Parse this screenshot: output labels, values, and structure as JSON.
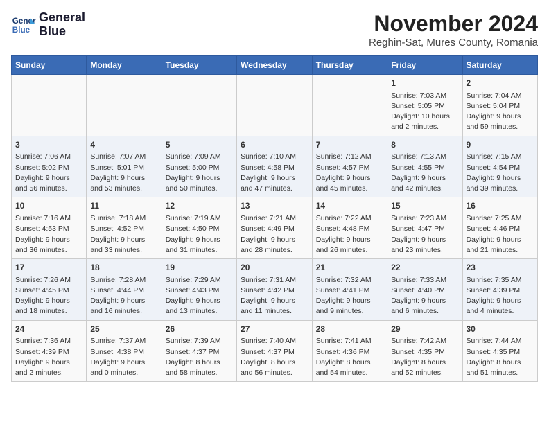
{
  "header": {
    "logo_line1": "General",
    "logo_line2": "Blue",
    "month_title": "November 2024",
    "subtitle": "Reghin-Sat, Mures County, Romania"
  },
  "weekdays": [
    "Sunday",
    "Monday",
    "Tuesday",
    "Wednesday",
    "Thursday",
    "Friday",
    "Saturday"
  ],
  "weeks": [
    [
      {
        "day": "",
        "details": ""
      },
      {
        "day": "",
        "details": ""
      },
      {
        "day": "",
        "details": ""
      },
      {
        "day": "",
        "details": ""
      },
      {
        "day": "",
        "details": ""
      },
      {
        "day": "1",
        "details": "Sunrise: 7:03 AM\nSunset: 5:05 PM\nDaylight: 10 hours\nand 2 minutes."
      },
      {
        "day": "2",
        "details": "Sunrise: 7:04 AM\nSunset: 5:04 PM\nDaylight: 9 hours\nand 59 minutes."
      }
    ],
    [
      {
        "day": "3",
        "details": "Sunrise: 7:06 AM\nSunset: 5:02 PM\nDaylight: 9 hours\nand 56 minutes."
      },
      {
        "day": "4",
        "details": "Sunrise: 7:07 AM\nSunset: 5:01 PM\nDaylight: 9 hours\nand 53 minutes."
      },
      {
        "day": "5",
        "details": "Sunrise: 7:09 AM\nSunset: 5:00 PM\nDaylight: 9 hours\nand 50 minutes."
      },
      {
        "day": "6",
        "details": "Sunrise: 7:10 AM\nSunset: 4:58 PM\nDaylight: 9 hours\nand 47 minutes."
      },
      {
        "day": "7",
        "details": "Sunrise: 7:12 AM\nSunset: 4:57 PM\nDaylight: 9 hours\nand 45 minutes."
      },
      {
        "day": "8",
        "details": "Sunrise: 7:13 AM\nSunset: 4:55 PM\nDaylight: 9 hours\nand 42 minutes."
      },
      {
        "day": "9",
        "details": "Sunrise: 7:15 AM\nSunset: 4:54 PM\nDaylight: 9 hours\nand 39 minutes."
      }
    ],
    [
      {
        "day": "10",
        "details": "Sunrise: 7:16 AM\nSunset: 4:53 PM\nDaylight: 9 hours\nand 36 minutes."
      },
      {
        "day": "11",
        "details": "Sunrise: 7:18 AM\nSunset: 4:52 PM\nDaylight: 9 hours\nand 33 minutes."
      },
      {
        "day": "12",
        "details": "Sunrise: 7:19 AM\nSunset: 4:50 PM\nDaylight: 9 hours\nand 31 minutes."
      },
      {
        "day": "13",
        "details": "Sunrise: 7:21 AM\nSunset: 4:49 PM\nDaylight: 9 hours\nand 28 minutes."
      },
      {
        "day": "14",
        "details": "Sunrise: 7:22 AM\nSunset: 4:48 PM\nDaylight: 9 hours\nand 26 minutes."
      },
      {
        "day": "15",
        "details": "Sunrise: 7:23 AM\nSunset: 4:47 PM\nDaylight: 9 hours\nand 23 minutes."
      },
      {
        "day": "16",
        "details": "Sunrise: 7:25 AM\nSunset: 4:46 PM\nDaylight: 9 hours\nand 21 minutes."
      }
    ],
    [
      {
        "day": "17",
        "details": "Sunrise: 7:26 AM\nSunset: 4:45 PM\nDaylight: 9 hours\nand 18 minutes."
      },
      {
        "day": "18",
        "details": "Sunrise: 7:28 AM\nSunset: 4:44 PM\nDaylight: 9 hours\nand 16 minutes."
      },
      {
        "day": "19",
        "details": "Sunrise: 7:29 AM\nSunset: 4:43 PM\nDaylight: 9 hours\nand 13 minutes."
      },
      {
        "day": "20",
        "details": "Sunrise: 7:31 AM\nSunset: 4:42 PM\nDaylight: 9 hours\nand 11 minutes."
      },
      {
        "day": "21",
        "details": "Sunrise: 7:32 AM\nSunset: 4:41 PM\nDaylight: 9 hours\nand 9 minutes."
      },
      {
        "day": "22",
        "details": "Sunrise: 7:33 AM\nSunset: 4:40 PM\nDaylight: 9 hours\nand 6 minutes."
      },
      {
        "day": "23",
        "details": "Sunrise: 7:35 AM\nSunset: 4:39 PM\nDaylight: 9 hours\nand 4 minutes."
      }
    ],
    [
      {
        "day": "24",
        "details": "Sunrise: 7:36 AM\nSunset: 4:39 PM\nDaylight: 9 hours\nand 2 minutes."
      },
      {
        "day": "25",
        "details": "Sunrise: 7:37 AM\nSunset: 4:38 PM\nDaylight: 9 hours\nand 0 minutes."
      },
      {
        "day": "26",
        "details": "Sunrise: 7:39 AM\nSunset: 4:37 PM\nDaylight: 8 hours\nand 58 minutes."
      },
      {
        "day": "27",
        "details": "Sunrise: 7:40 AM\nSunset: 4:37 PM\nDaylight: 8 hours\nand 56 minutes."
      },
      {
        "day": "28",
        "details": "Sunrise: 7:41 AM\nSunset: 4:36 PM\nDaylight: 8 hours\nand 54 minutes."
      },
      {
        "day": "29",
        "details": "Sunrise: 7:42 AM\nSunset: 4:35 PM\nDaylight: 8 hours\nand 52 minutes."
      },
      {
        "day": "30",
        "details": "Sunrise: 7:44 AM\nSunset: 4:35 PM\nDaylight: 8 hours\nand 51 minutes."
      }
    ]
  ]
}
